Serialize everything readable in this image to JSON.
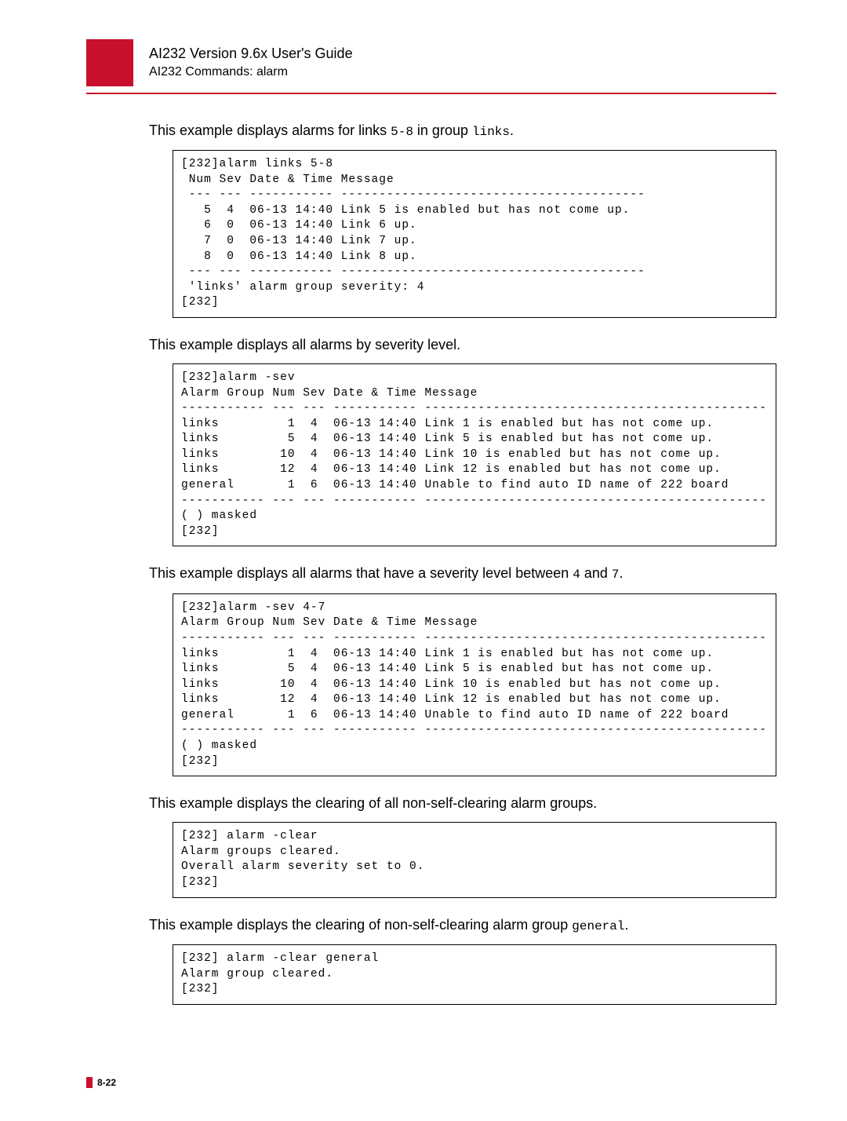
{
  "header": {
    "title": "AI232 Version 9.6x User's Guide",
    "subtitle": "AI232 Commands: alarm"
  },
  "para1": {
    "pre": "This example displays alarms for links ",
    "code1": "5-8",
    "mid": " in group ",
    "code2": "links",
    "post": "."
  },
  "code1": "[232]alarm links 5-8\n Num Sev Date & Time Message\n --- --- ----------- ----------------------------------------\n   5  4  06-13 14:40 Link 5 is enabled but has not come up.\n   6  0  06-13 14:40 Link 6 up.\n   7  0  06-13 14:40 Link 7 up.\n   8  0  06-13 14:40 Link 8 up.\n --- --- ----------- ----------------------------------------\n 'links' alarm group severity: 4\n[232]",
  "para2": "This example displays all alarms by severity level.",
  "code2": "[232]alarm -sev\nAlarm Group Num Sev Date & Time Message\n----------- --- --- ----------- ---------------------------------------------\nlinks         1  4  06-13 14:40 Link 1 is enabled but has not come up.\nlinks         5  4  06-13 14:40 Link 5 is enabled but has not come up.\nlinks        10  4  06-13 14:40 Link 10 is enabled but has not come up.\nlinks        12  4  06-13 14:40 Link 12 is enabled but has not come up.\ngeneral       1  6  06-13 14:40 Unable to find auto ID name of 222 board\n----------- --- --- ----------- ---------------------------------------------\n( ) masked\n[232]",
  "para3": {
    "pre": "This example displays all alarms that have a severity level between ",
    "code1": "4",
    "mid": " and ",
    "code2": "7",
    "post": "."
  },
  "code3": "[232]alarm -sev 4-7\nAlarm Group Num Sev Date & Time Message\n----------- --- --- ----------- ---------------------------------------------\nlinks         1  4  06-13 14:40 Link 1 is enabled but has not come up.\nlinks         5  4  06-13 14:40 Link 5 is enabled but has not come up.\nlinks        10  4  06-13 14:40 Link 10 is enabled but has not come up.\nlinks        12  4  06-13 14:40 Link 12 is enabled but has not come up.\ngeneral       1  6  06-13 14:40 Unable to find auto ID name of 222 board\n----------- --- --- ----------- ---------------------------------------------\n( ) masked\n[232]",
  "para4": "This example displays the clearing of all non-self-clearing alarm groups.",
  "code4": "[232] alarm -clear\nAlarm groups cleared.\nOverall alarm severity set to 0.\n[232]",
  "para5": {
    "pre": "This example displays the clearing of non-self-clearing alarm group ",
    "code1": "general",
    "post": "."
  },
  "code5": "[232] alarm -clear general\nAlarm group cleared.\n[232]",
  "footer": "8-22"
}
